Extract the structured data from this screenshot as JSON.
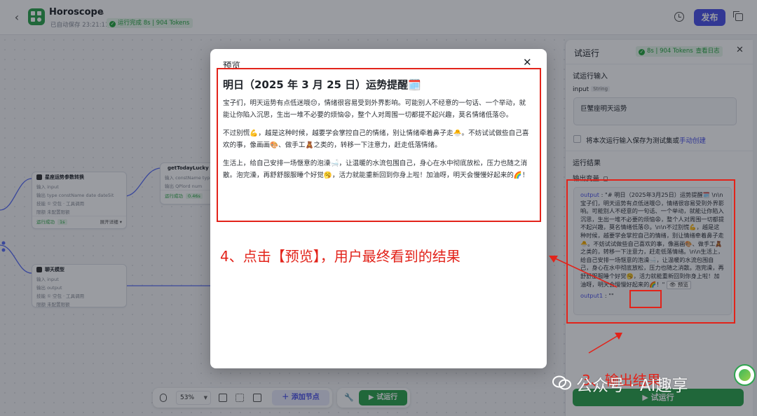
{
  "header": {
    "app_title": "Horoscope",
    "autosave": "已自动保存 23:21:11",
    "run_status": "运行完成 8s | 904 Tokens",
    "publish_label": "发布"
  },
  "canvas": {
    "nodes": [
      {
        "title": "星座运势参数转换",
        "rows": [
          "输入 input",
          "输出 type constName date date5it",
          "技能 ① 空包 · 工具调用",
          "限额 未配置限额"
        ],
        "status": "运行成功",
        "status_badge": "1s",
        "status_extra": "展开详细 ▾"
      },
      {
        "title": "getTodayLucky",
        "rows": [
          "输入 constName type",
          "输出 QPlord num"
        ],
        "status": "运行成功",
        "status_badge": "0.46s"
      },
      {
        "title": "聊天模型",
        "rows": [
          "输入 input",
          "输出 output",
          "技能 ① 空包 · 工具调用",
          "限额 未配置限额"
        ]
      }
    ]
  },
  "toolbar": {
    "zoom": "53%",
    "add_node_label": "添加节点",
    "test_run_label": "试运行"
  },
  "panel": {
    "title": "试运行",
    "badge": "8s | 904 Tokens",
    "view_log": "查看日志",
    "input_section": "试运行输入",
    "input_field_label": "input",
    "input_field_type": "String",
    "input_value": "巨蟹座明天运势",
    "save_checkbox_label": "将本次运行输入保存为测试集或",
    "manual_create_link": "手动创建",
    "result_section": "运行结果",
    "output_var_label": "输出变量",
    "output_key": "output",
    "output_text": "\"# 明日（2025年3月25日）运势提醒🗓️ \\n\\n宝子们，明天运势有点低迷哦😔，情绪很容易受到外界影响。可能别人不经意的一句话、一个举动，就能让你陷入沉思，生出一堆不必要的烦恼😩，整个人对周围一切都提不起兴趣，莫名情绪低落😣。\\n\\n不过别慌💪，越是这种时候，越要学会掌控自己的情绪，别让情绪牵着鼻子走🐣。不妨试试做些自己喜欢的事，像画画🎨、做手工🧸之类的，转移一下注意力，赶走低落情绪。\\n\\n生活上，给自己安排一场惬意的泡澡🛁，让温暖的水流包围自己，身心在水中彻底放松，压力也随之消散。泡完澡，再舒舒服服睡个好觉🥱，活力就能重新回到你身上啦！加油呀，明天会慢慢好起来的🌈！\"",
    "preview_btn": "👁 预览",
    "output1_key": "output1",
    "output1_value": "\"\"",
    "run_btn": "试运行"
  },
  "modal": {
    "title": "预览",
    "heading": "明日（2025 年 3 月 25 日）运势提醒🗓️",
    "paragraphs": [
      "宝子们，明天运势有点低迷哦😔，情绪很容易受到外界影响。可能别人不经意的一句话、一个举动，就能让你陷入沉思，生出一堆不必要的烦恼😩，整个人对周围一切都提不起兴趣，莫名情绪低落😣。",
      "不过别慌💪，越是这种时候，越要学会掌控自己的情绪，别让情绪牵着鼻子走🐣。不妨试试做些自己喜欢的事，像画画🎨、做手工🧸之类的，转移一下注意力，赶走低落情绪。",
      "生活上，给自己安排一场惬意的泡澡🛁，让温暖的水流包围自己，身心在水中彻底放松，压力也随之消散。泡完澡，再舒舒服服睡个好觉🥱，活力就能重新回到你身上啦！加油呀，明天会慢慢好起来的🌈！"
    ]
  },
  "annotations": {
    "step4": "4、点击【预览】，用户最终看到的结果",
    "step3": "3、输出结果"
  },
  "watermark": {
    "text": "公众号 · AI趣享"
  },
  "colors": {
    "accent": "#4d53e8",
    "success": "#2ea44f",
    "annotation": "#e2231a"
  }
}
